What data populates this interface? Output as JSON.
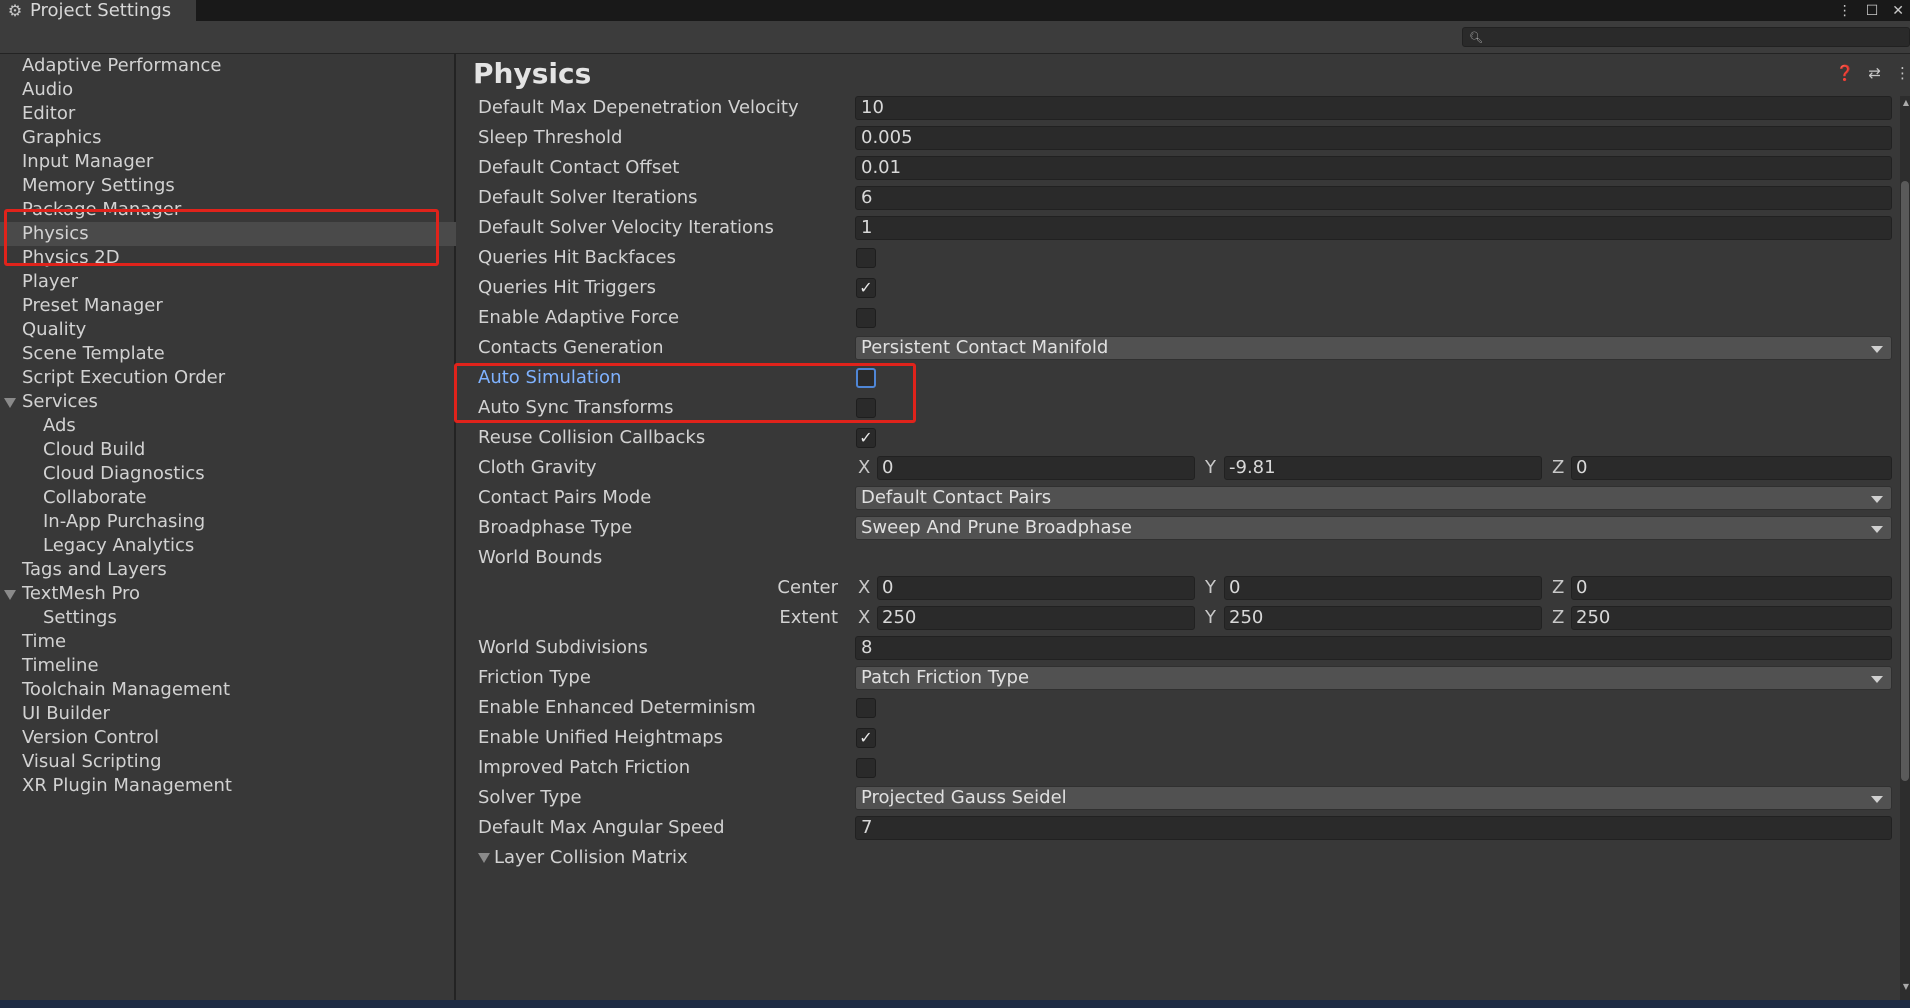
{
  "window": {
    "title": "Project Settings",
    "icons": {
      "gear": "gear-icon",
      "menu": "kebab-menu-icon",
      "maximize": "maximize-icon",
      "close": "close-icon"
    }
  },
  "search": {
    "placeholder": "",
    "value": ""
  },
  "sidebar": {
    "items": [
      {
        "label": "Adaptive Performance"
      },
      {
        "label": "Audio"
      },
      {
        "label": "Editor"
      },
      {
        "label": "Graphics"
      },
      {
        "label": "Input Manager"
      },
      {
        "label": "Memory Settings"
      },
      {
        "label": "Package Manager"
      },
      {
        "label": "Physics",
        "selected": true
      },
      {
        "label": "Physics 2D"
      },
      {
        "label": "Player"
      },
      {
        "label": "Preset Manager"
      },
      {
        "label": "Quality"
      },
      {
        "label": "Scene Template"
      },
      {
        "label": "Script Execution Order"
      },
      {
        "label": "Services",
        "expanded": true
      },
      {
        "label": "Ads",
        "child": true
      },
      {
        "label": "Cloud Build",
        "child": true
      },
      {
        "label": "Cloud Diagnostics",
        "child": true
      },
      {
        "label": "Collaborate",
        "child": true
      },
      {
        "label": "In-App Purchasing",
        "child": true
      },
      {
        "label": "Legacy Analytics",
        "child": true
      },
      {
        "label": "Tags and Layers"
      },
      {
        "label": "TextMesh Pro",
        "expanded": true
      },
      {
        "label": "Settings",
        "child": true
      },
      {
        "label": "Time"
      },
      {
        "label": "Timeline"
      },
      {
        "label": "Toolchain Management"
      },
      {
        "label": "UI Builder"
      },
      {
        "label": "Version Control"
      },
      {
        "label": "Visual Scripting"
      },
      {
        "label": "XR Plugin Management"
      }
    ]
  },
  "main": {
    "title": "Physics",
    "header_icons": [
      "help-icon",
      "preset-icon",
      "kebab-menu-icon"
    ],
    "rows": {
      "max_depenetration": {
        "label": "Default Max Depenetration Velocity",
        "value": "10"
      },
      "sleep_threshold": {
        "label": "Sleep Threshold",
        "value": "0.005"
      },
      "contact_offset": {
        "label": "Default Contact Offset",
        "value": "0.01"
      },
      "solver_iterations": {
        "label": "Default Solver Iterations",
        "value": "6"
      },
      "solver_velocity_iterations": {
        "label": "Default Solver Velocity Iterations",
        "value": "1"
      },
      "queries_hit_backfaces": {
        "label": "Queries Hit Backfaces",
        "checked": false
      },
      "queries_hit_triggers": {
        "label": "Queries Hit Triggers",
        "checked": true
      },
      "enable_adaptive_force": {
        "label": "Enable Adaptive Force",
        "checked": false
      },
      "contacts_generation": {
        "label": "Contacts Generation",
        "value": "Persistent Contact Manifold"
      },
      "auto_simulation": {
        "label": "Auto Simulation",
        "checked": false
      },
      "auto_sync_transforms": {
        "label": "Auto Sync Transforms",
        "checked": false
      },
      "reuse_collision_callbacks": {
        "label": "Reuse Collision Callbacks",
        "checked": true
      },
      "cloth_gravity": {
        "label": "Cloth Gravity",
        "x": "0",
        "y": "-9.81",
        "z": "0"
      },
      "contact_pairs_mode": {
        "label": "Contact Pairs Mode",
        "value": "Default Contact Pairs"
      },
      "broadphase_type": {
        "label": "Broadphase Type",
        "value": "Sweep And Prune Broadphase"
      },
      "world_bounds": {
        "label": "World Bounds",
        "center": {
          "label": "Center",
          "x": "0",
          "y": "0",
          "z": "0"
        },
        "extent": {
          "label": "Extent",
          "x": "250",
          "y": "250",
          "z": "250"
        }
      },
      "world_subdivisions": {
        "label": "World Subdivisions",
        "value": "8"
      },
      "friction_type": {
        "label": "Friction Type",
        "value": "Patch Friction Type"
      },
      "enhanced_determinism": {
        "label": "Enable Enhanced Determinism",
        "checked": false
      },
      "unified_heightmaps": {
        "label": "Enable Unified Heightmaps",
        "checked": true
      },
      "improved_patch_friction": {
        "label": "Improved Patch Friction",
        "checked": false
      },
      "solver_type": {
        "label": "Solver Type",
        "value": "Projected Gauss Seidel"
      },
      "max_angular_speed": {
        "label": "Default Max Angular Speed",
        "value": "7"
      },
      "layer_collision_matrix": {
        "label": "Layer Collision Matrix"
      }
    },
    "axis": {
      "x": "X",
      "y": "Y",
      "z": "Z"
    }
  },
  "colors": {
    "highlight_box": "#e0231b",
    "accent_label": "#7fb2ff",
    "background": "#383838"
  }
}
